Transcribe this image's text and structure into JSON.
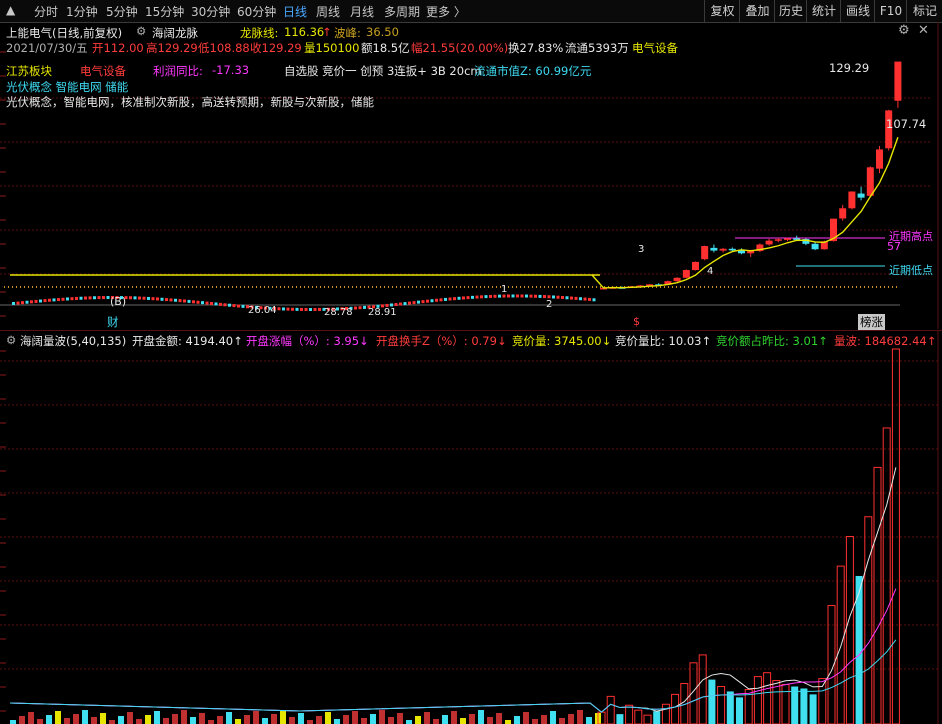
{
  "toolbar": {
    "periods": [
      "分时",
      "1分钟",
      "5分钟",
      "15分钟",
      "30分钟",
      "60分钟",
      "日线",
      "周线",
      "月线",
      "多周期",
      "更多 〉"
    ],
    "active_period": "日线",
    "buttons": [
      "复权",
      "叠加",
      "历史",
      "统计",
      "画线",
      "F10",
      "标记"
    ]
  },
  "stock_header": {
    "name": "上能电气(日线,前复权)",
    "indicator": "海阔龙脉",
    "longmai_label": "龙脉线:",
    "longmai_value": "116.36",
    "bofeng_label": "波峰:",
    "bofeng_value": "36.50"
  },
  "ohlc": {
    "date": "2021/07/30/五",
    "open": "开112.00",
    "high": "高129.29",
    "low": "低108.88",
    "close": "收129.29",
    "volume": "量150100",
    "amount": "额18.5亿",
    "change": "幅21.55(20.00%)",
    "turnover": "换27.83%",
    "float": "流通5393万",
    "industry": "电气设备"
  },
  "info_rows": {
    "region": "江苏板块",
    "sector": "电气设备",
    "profit_label": "利润同比:",
    "profit_value": "-17.33",
    "tags": "自选股  竞价一  创预  3连扳+  3B  20cm",
    "market_cap": "流通市值Z:  60.99亿元",
    "concepts_short": "光伏概念  智能电网  储能",
    "concepts_full": "光伏概念，智能电网，核准制次新股，高送转预期，新股与次新股，储能"
  },
  "price_labels": {
    "high_price": "129.29",
    "right_price": "107.74",
    "near_high": "近期高点",
    "near_high_val": "57",
    "near_low": "近期低点",
    "low_mark_1": "26.04",
    "low_mark_2": "28.78",
    "low_mark_3": "28.91",
    "b_mark": "(B)",
    "num_1": "1",
    "num_2": "2",
    "num_3": "3",
    "num_4": "4",
    "cai": "财",
    "s_mark": "$",
    "bangzhang": "榜涨"
  },
  "sub_header": {
    "name": "海阔量波(5,40,135)",
    "kaipan_jine": "开盘金额: 4194.40↑",
    "kaipan_zhangfu": "开盘涨幅（%）: 3.95↓",
    "kaipan_huanshou": "开盘换手Z（%）: 0.79↓",
    "jingjialiang": "竞价量: 3745.00↓",
    "jingjia_liangbi": "竞价量比: 10.03↑",
    "jingjia_zhanbi": "竞价额占昨比: 3.01↑",
    "liangbo": "量波: 184682.44↑"
  },
  "colors": {
    "up": "#ff3030",
    "down": "#40e0f0",
    "ma_yellow": "#e6e600",
    "magenta": "#ff38ff",
    "grid": "#5a0c0c"
  },
  "chart_data": {
    "type": "bar",
    "title": "",
    "note": "daily K-line (last ~30 sessions shown prominently) and volume histogram",
    "candles": [
      {
        "o": 29.0,
        "h": 29.6,
        "l": 28.8,
        "c": 29.3
      },
      {
        "o": 29.3,
        "h": 29.8,
        "l": 29.0,
        "c": 29.6
      },
      {
        "o": 29.6,
        "h": 30.0,
        "l": 29.2,
        "c": 29.4
      },
      {
        "o": 29.4,
        "h": 30.2,
        "l": 29.3,
        "c": 30.0
      },
      {
        "o": 30.0,
        "h": 30.6,
        "l": 29.8,
        "c": 30.4
      },
      {
        "o": 30.4,
        "h": 31.0,
        "l": 30.2,
        "c": 30.9
      },
      {
        "o": 30.9,
        "h": 31.4,
        "l": 30.6,
        "c": 30.7
      },
      {
        "o": 30.7,
        "h": 32.5,
        "l": 30.6,
        "c": 32.3
      },
      {
        "o": 32.3,
        "h": 34.0,
        "l": 32.0,
        "c": 33.8
      },
      {
        "o": 33.8,
        "h": 37.5,
        "l": 33.6,
        "c": 37.2
      },
      {
        "o": 37.2,
        "h": 41.0,
        "l": 37.0,
        "c": 40.8
      },
      {
        "o": 42.0,
        "h": 48.0,
        "l": 41.5,
        "c": 47.8
      },
      {
        "o": 47.0,
        "h": 48.5,
        "l": 45.0,
        "c": 45.8
      },
      {
        "o": 45.8,
        "h": 47.0,
        "l": 45.0,
        "c": 46.6
      },
      {
        "o": 46.6,
        "h": 47.2,
        "l": 45.5,
        "c": 45.9
      },
      {
        "o": 45.9,
        "h": 46.8,
        "l": 44.2,
        "c": 44.6
      },
      {
        "o": 44.6,
        "h": 46.0,
        "l": 43.0,
        "c": 45.6
      },
      {
        "o": 45.6,
        "h": 49.0,
        "l": 45.2,
        "c": 48.5
      },
      {
        "o": 48.5,
        "h": 51.0,
        "l": 48.0,
        "c": 50.2
      },
      {
        "o": 50.2,
        "h": 51.5,
        "l": 49.5,
        "c": 50.8
      },
      {
        "o": 50.8,
        "h": 51.6,
        "l": 50.0,
        "c": 51.2
      },
      {
        "o": 51.2,
        "h": 52.4,
        "l": 50.6,
        "c": 50.9
      },
      {
        "o": 50.9,
        "h": 51.2,
        "l": 48.2,
        "c": 48.8
      },
      {
        "o": 48.8,
        "h": 49.6,
        "l": 46.0,
        "c": 46.4
      },
      {
        "o": 46.4,
        "h": 50.2,
        "l": 46.2,
        "c": 49.9
      },
      {
        "o": 50.0,
        "h": 60.0,
        "l": 49.8,
        "c": 59.9
      },
      {
        "o": 60.0,
        "h": 66.0,
        "l": 59.0,
        "c": 64.5
      },
      {
        "o": 64.5,
        "h": 72.0,
        "l": 64.0,
        "c": 71.9
      },
      {
        "o": 71.0,
        "h": 74.0,
        "l": 68.0,
        "c": 69.2
      },
      {
        "o": 70.0,
        "h": 83.0,
        "l": 69.5,
        "c": 82.6
      },
      {
        "o": 82.0,
        "h": 92.0,
        "l": 80.0,
        "c": 90.5
      },
      {
        "o": 91.0,
        "h": 108.0,
        "l": 90.0,
        "c": 107.74
      },
      {
        "o": 112.0,
        "h": 129.29,
        "l": 108.88,
        "c": 129.29
      }
    ],
    "volumes": [
      12,
      28,
      10,
      19,
      14,
      9,
      13,
      20,
      30,
      41,
      62,
      70,
      45,
      38,
      33,
      27,
      35,
      48,
      52,
      44,
      40,
      38,
      36,
      30,
      46,
      120,
      160,
      190,
      150,
      210,
      260,
      300,
      380
    ]
  }
}
